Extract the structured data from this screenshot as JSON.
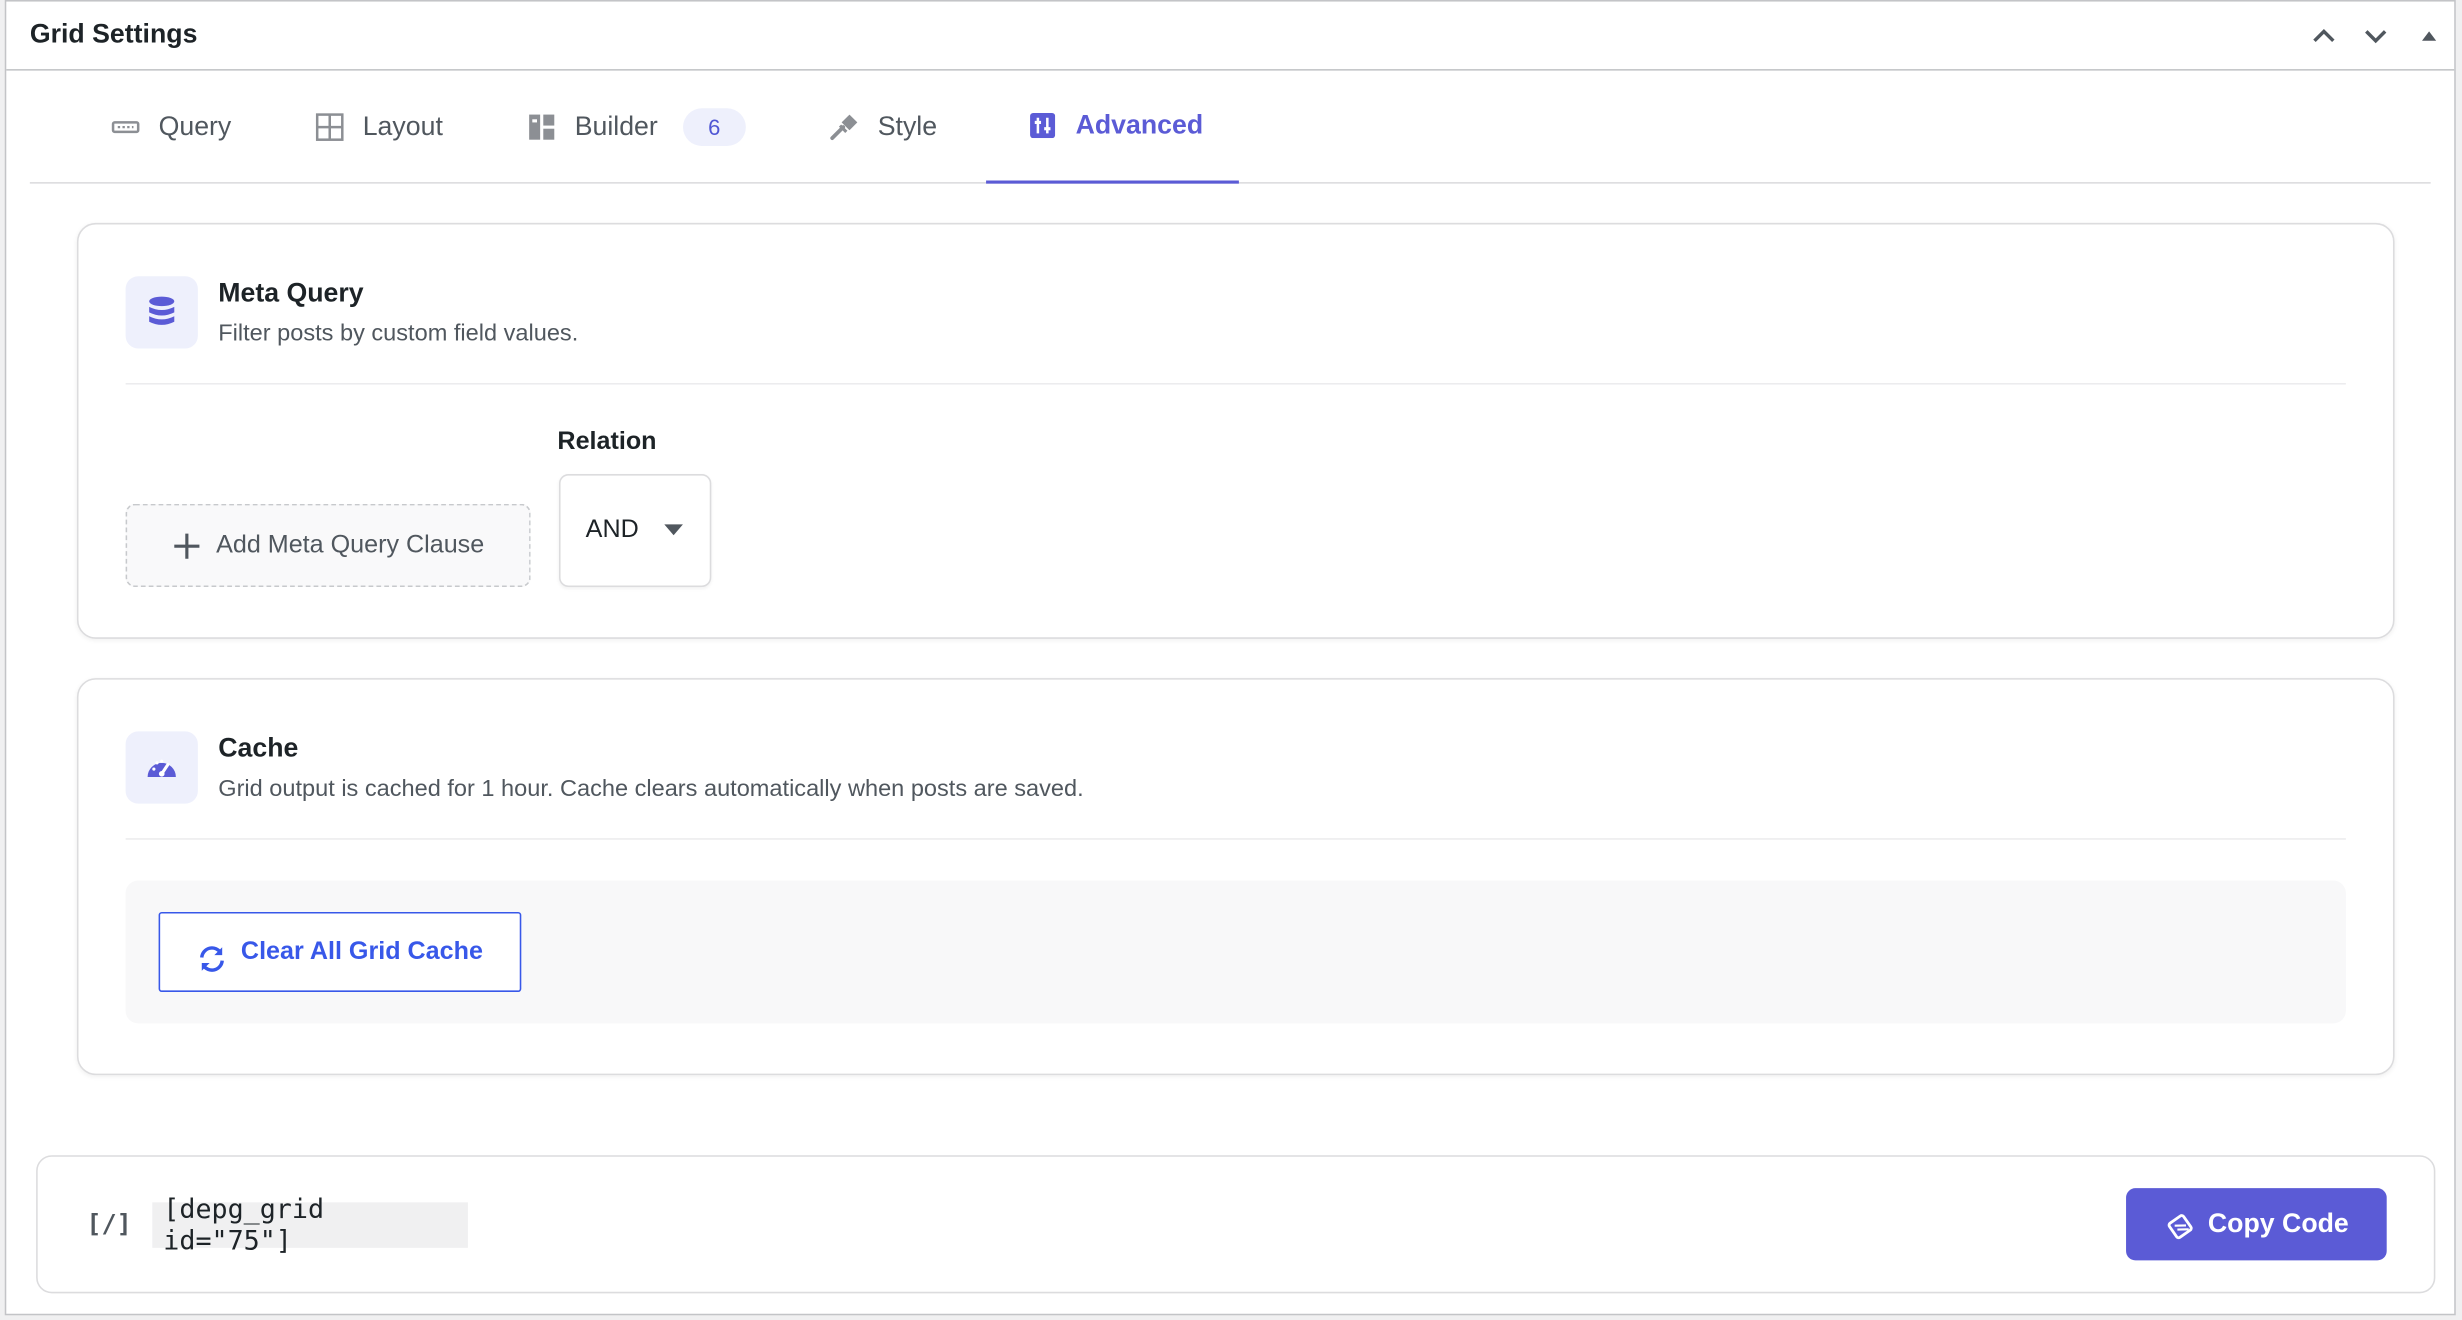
{
  "header": {
    "title": "Grid Settings"
  },
  "header_controls": [
    {
      "name": "move-up-button",
      "icon": "chevron-up-icon"
    },
    {
      "name": "move-down-button",
      "icon": "chevron-down-icon"
    },
    {
      "name": "toggle-panel-button",
      "icon": "triangle-up-icon"
    }
  ],
  "tabs": [
    {
      "label": "Query",
      "icon": "query-icon",
      "active": false
    },
    {
      "label": "Layout",
      "icon": "layout-grid-icon",
      "active": false
    },
    {
      "label": "Builder",
      "icon": "builder-icon",
      "badge": "6",
      "active": false
    },
    {
      "label": "Style",
      "icon": "brush-icon",
      "active": false
    },
    {
      "label": "Advanced",
      "icon": "advanced-icon",
      "active": true
    }
  ],
  "meta_query": {
    "icon": "database-icon",
    "title": "Meta Query",
    "description": "Filter posts by custom field values.",
    "add_button_label": "Add Meta Query Clause",
    "relation_label": "Relation",
    "relation_value": "AND"
  },
  "cache": {
    "icon": "dashboard-gauge-icon",
    "title": "Cache",
    "description": "Grid output is cached for 1 hour. Cache clears automatically when posts are saved.",
    "clear_button_label": "Clear All Grid Cache"
  },
  "shortcode": {
    "icon_text": "[/]",
    "code": "[depg_grid id=\"75\"]",
    "copy_button_label": "Copy Code"
  },
  "colors": {
    "accent": "#5b5bd6",
    "link_blue": "#3858e9",
    "icon_bg": "#eef0fc"
  }
}
